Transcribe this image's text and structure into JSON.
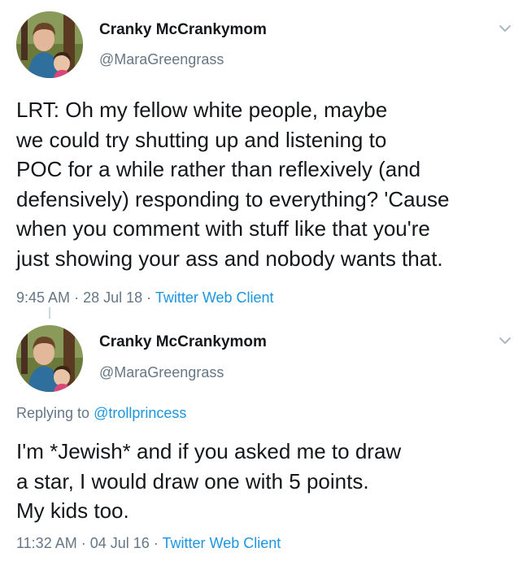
{
  "tweets": [
    {
      "author_name": "Cranky McCrankymom",
      "author_handle": "@MaraGreengrass",
      "text": "LRT: Oh my fellow white people, maybe\nwe could try shutting up and listening to\nPOC for a while rather than reflexively (and\ndefensively) responding to everything? 'Cause\nwhen you comment with stuff like that you're\njust showing your ass and nobody wants that.",
      "time": "9:45 AM",
      "date": "28 Jul 18",
      "separator": "·",
      "client": "Twitter Web Client",
      "avatar_icon": "profile-photo",
      "menu_icon": "chevron-down-icon"
    },
    {
      "author_name": "Cranky McCrankymom",
      "author_handle": "@MaraGreengrass",
      "reply_prefix": "Replying to",
      "reply_mention": "@trollprincess",
      "text": "I'm *Jewish* and if you asked me to draw\na star, I would draw one with 5 points.\nMy kids too.",
      "time": "11:32 AM",
      "date": "04 Jul 16",
      "separator": "·",
      "client": "Twitter Web Client",
      "avatar_icon": "profile-photo",
      "menu_icon": "chevron-down-icon"
    }
  ],
  "colors": {
    "text": "#14171a",
    "secondary": "#657786",
    "link": "#1b95e0"
  }
}
